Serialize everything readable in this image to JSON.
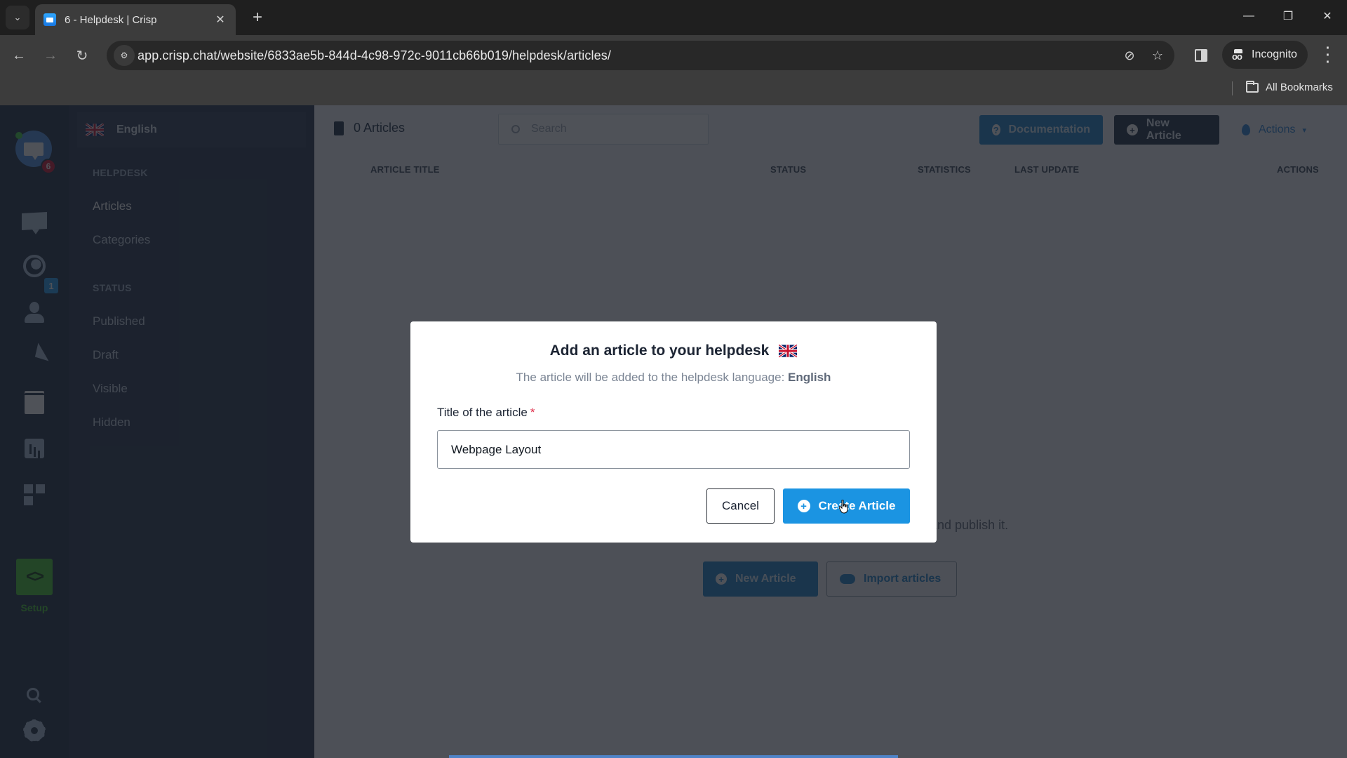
{
  "browser": {
    "tab_title": "6 - Helpdesk | Crisp",
    "tab_unread_icon": "chat-bubble-icon",
    "url": "app.crisp.chat/website/6833ae5b-844d-4c98-972c-9011cb66b019/helpdesk/articles/",
    "profile_label": "Incognito",
    "bookmarks_label": "All Bookmarks",
    "window_controls": [
      "minimize",
      "restore",
      "close"
    ]
  },
  "rail": {
    "avatar_badge": "6",
    "visitors_badge": "1",
    "items": [
      "inbox",
      "visitors",
      "contacts",
      "campaigns",
      "helpdesk",
      "analytics",
      "plugins"
    ],
    "setup_label": "Setup",
    "setup_glyph": "<>",
    "colors": {
      "setup": "#43c82c",
      "rail_bg": "#1c2b40"
    }
  },
  "sidebar": {
    "language": "English",
    "helpdesk_heading": "HELPDESK",
    "helpdesk_items": [
      {
        "label": "Articles",
        "active": true
      },
      {
        "label": "Categories",
        "active": false
      }
    ],
    "status_heading": "STATUS",
    "status_items": [
      {
        "label": "Published"
      },
      {
        "label": "Draft"
      },
      {
        "label": "Visible"
      },
      {
        "label": "Hidden"
      }
    ]
  },
  "main": {
    "article_count": "0 Articles",
    "search_placeholder": "Search",
    "documentation_label": "Documentation",
    "new_article_label": "New Article",
    "actions_label": "Actions",
    "columns": [
      "ARTICLE TITLE",
      "STATUS",
      "STATISTICS",
      "LAST UPDATE",
      "ACTIONS"
    ],
    "empty_text_visible": "and publish it.",
    "empty_new_article_label": "New Article",
    "import_label": "Import articles"
  },
  "modal": {
    "title": "Add an article to your helpdesk",
    "subtitle_prefix": "The article will be added to the helpdesk language:",
    "subtitle_language": "English",
    "field_label": "Title of the article",
    "required_mark": "*",
    "input_value": "Webpage Layout",
    "cancel_label": "Cancel",
    "create_label": "Create Article",
    "colors": {
      "primary": "#1b94e2",
      "required": "#e0344f"
    }
  }
}
